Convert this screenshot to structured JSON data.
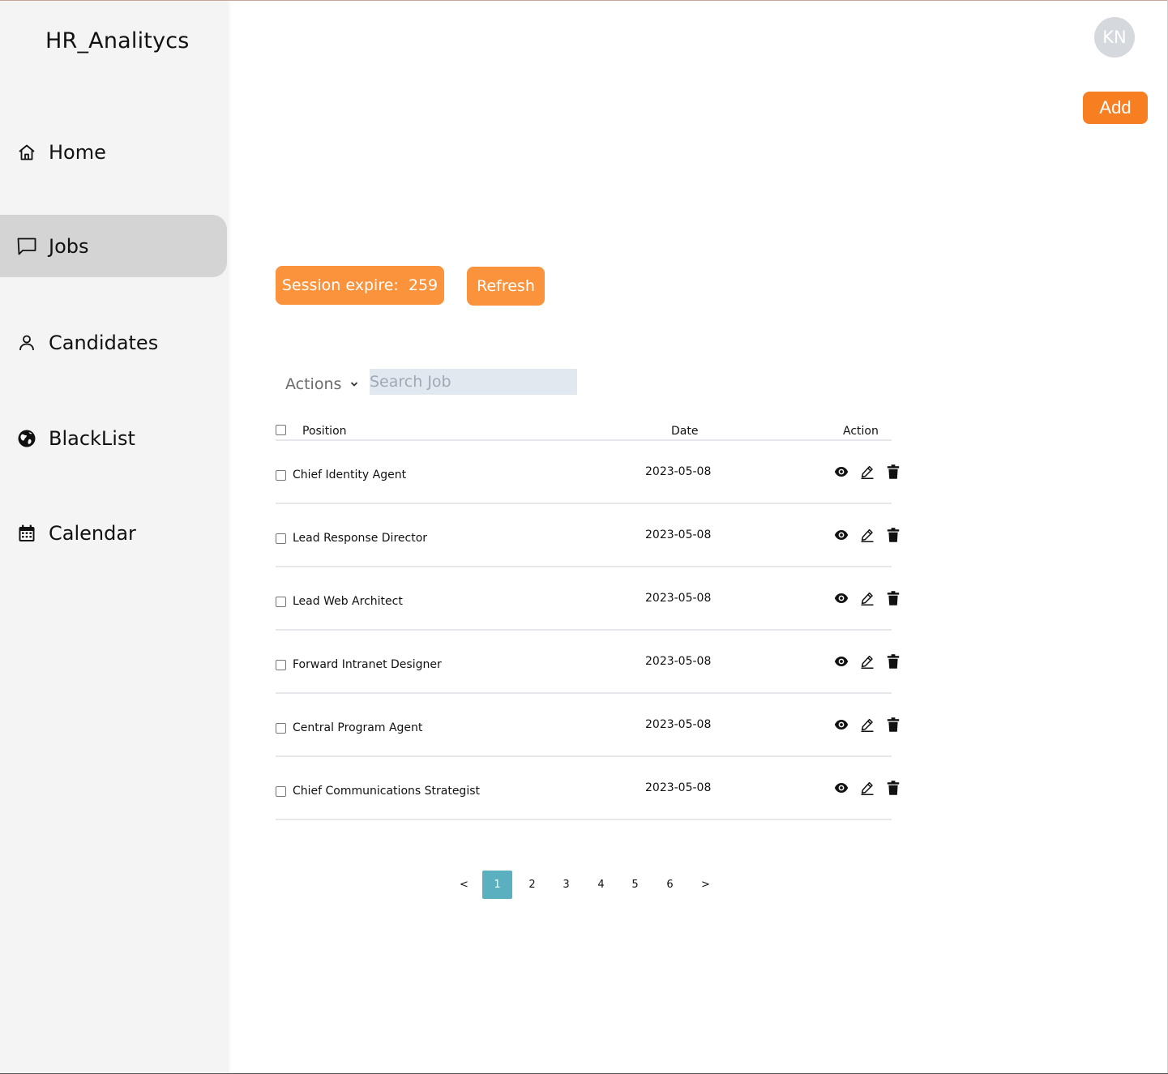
{
  "app": {
    "title": "HR_Analitycs"
  },
  "sidebar": {
    "items": [
      {
        "label": "Home",
        "icon": "home-icon",
        "active": false
      },
      {
        "label": "Jobs",
        "icon": "chat-bubble-icon",
        "active": true
      },
      {
        "label": "Candidates",
        "icon": "user-icon",
        "active": false
      },
      {
        "label": "BlackList",
        "icon": "globe-icon",
        "active": false
      },
      {
        "label": "Calendar",
        "icon": "calendar-icon",
        "active": false
      }
    ]
  },
  "header": {
    "avatar_initials": "KN",
    "add_label": "Add"
  },
  "session": {
    "label": "Session expire:  259",
    "refresh_label": "Refresh"
  },
  "toolbar": {
    "actions_label": "Actions",
    "search_placeholder": "Search Job"
  },
  "table": {
    "headers": {
      "position": "Position",
      "date": "Date",
      "action": "Action"
    },
    "rows": [
      {
        "position": "Chief Identity Agent",
        "date": "2023-05-08"
      },
      {
        "position": "Lead Response Director",
        "date": "2023-05-08"
      },
      {
        "position": "Lead Web Architect",
        "date": "2023-05-08"
      },
      {
        "position": "Forward Intranet Designer",
        "date": "2023-05-08"
      },
      {
        "position": "Central Program Agent",
        "date": "2023-05-08"
      },
      {
        "position": "Chief Communications Strategist",
        "date": "2023-05-08"
      }
    ],
    "row_actions": [
      "eye-icon",
      "edit-icon",
      "trash-icon"
    ]
  },
  "pagination": {
    "prev": "<",
    "pages": [
      "1",
      "2",
      "3",
      "4",
      "5",
      "6"
    ],
    "current": "1",
    "next": ">"
  },
  "colors": {
    "accent": "#f77f22",
    "session_button": "#fb923c",
    "active_page": "#5bb0bf",
    "sidebar_bg": "#f4f4f4",
    "active_nav": "#d4d4d4",
    "search_bg": "#e2e8f0"
  }
}
